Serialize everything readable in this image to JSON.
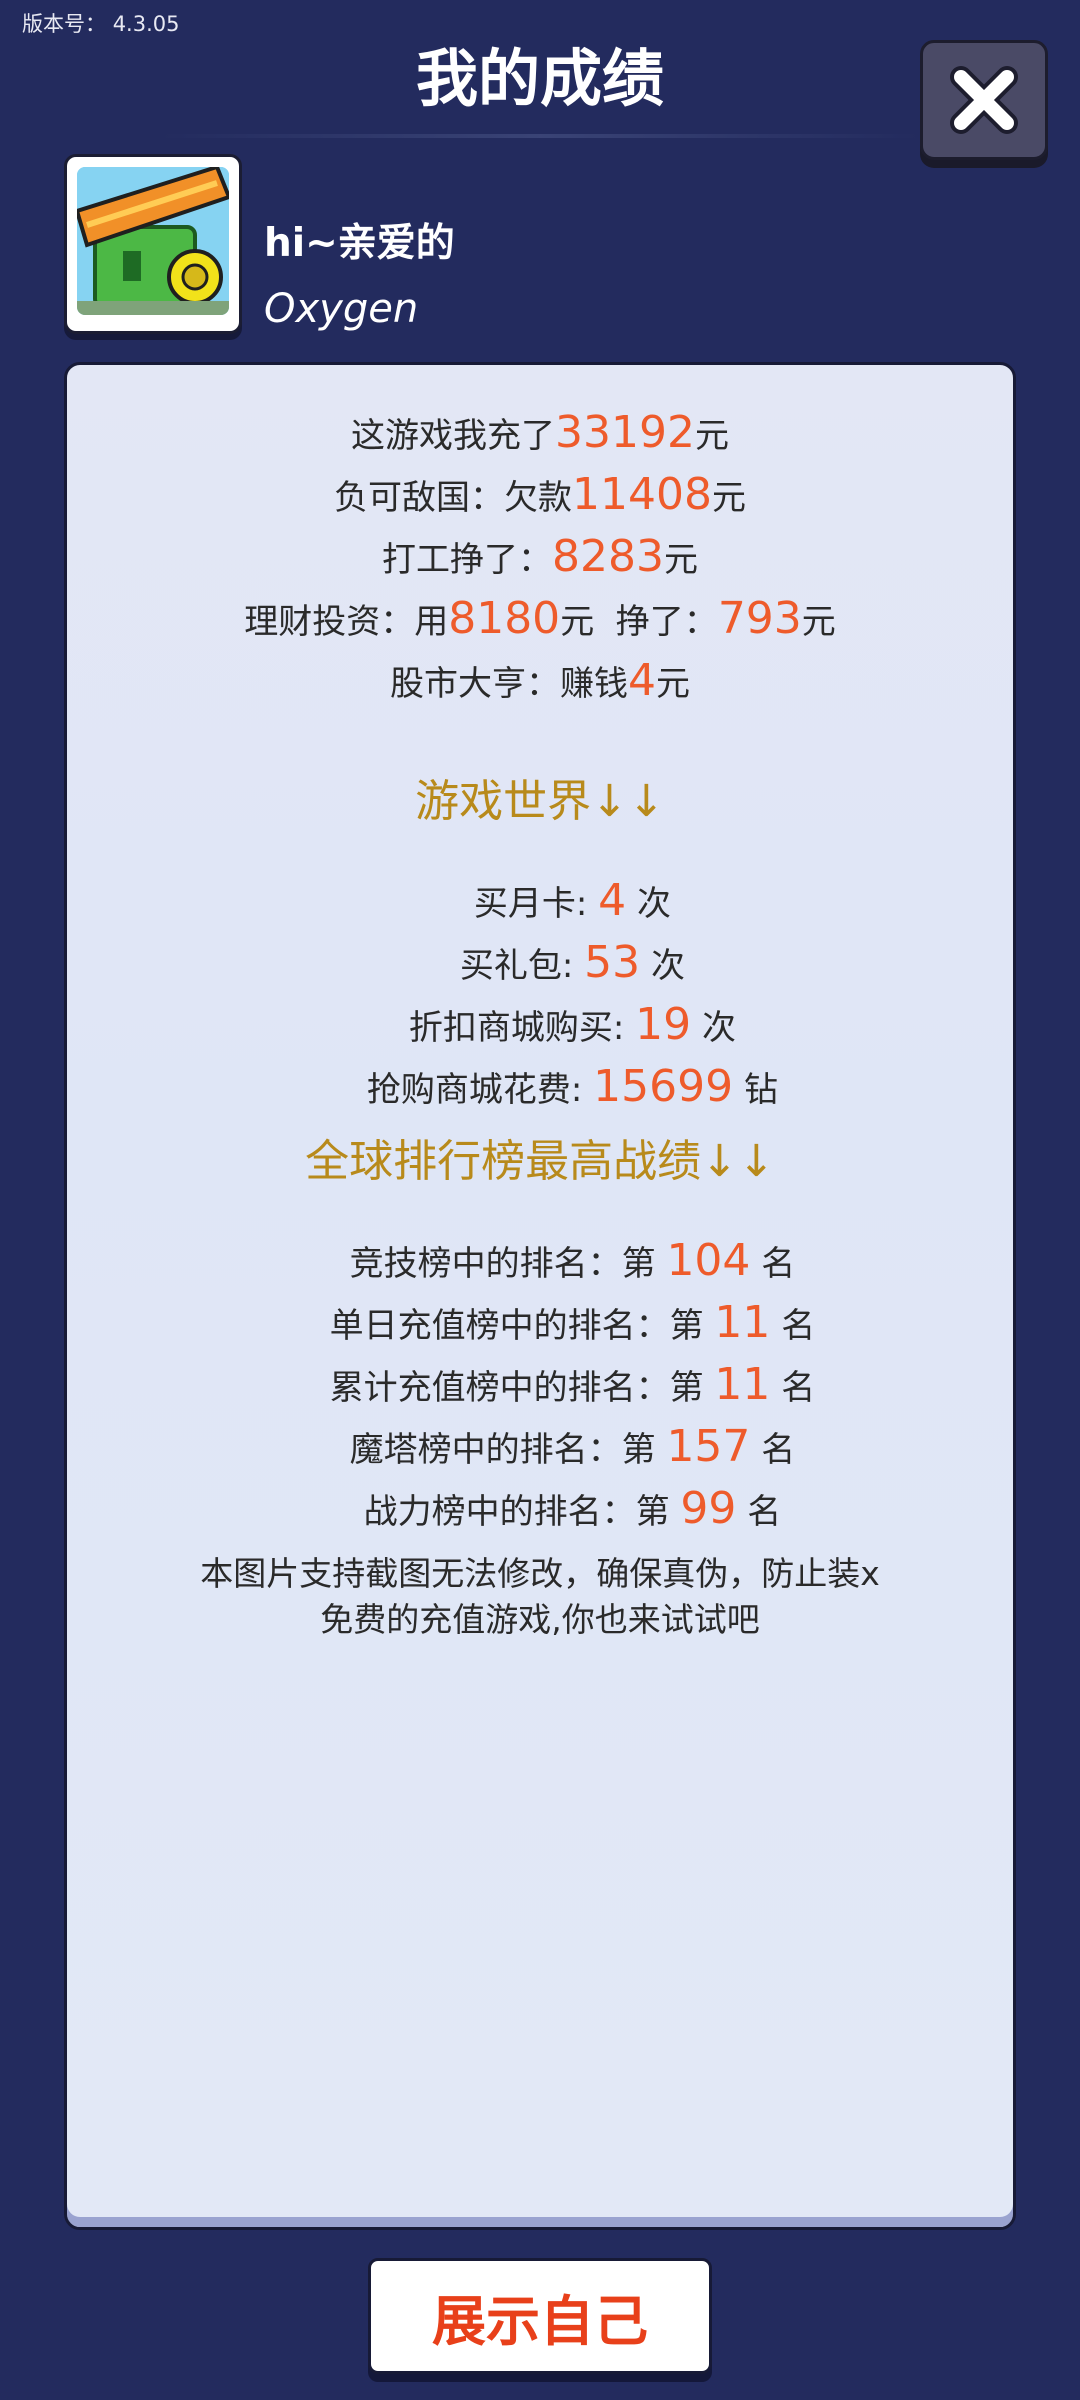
{
  "header": {
    "version_label": "版本号：",
    "version_value": "4.3.05",
    "title": "我的成绩"
  },
  "profile": {
    "greeting": "hi~亲爱的",
    "username": "Oxygen",
    "avatar_icon": "game-character-avatar"
  },
  "stats": {
    "recharge": {
      "prefix": "这游戏我充了",
      "value": "33192",
      "suffix": "元"
    },
    "debt": {
      "prefix": "负可敌国：欠款",
      "value": "11408",
      "suffix": "元"
    },
    "work": {
      "prefix": "打工挣了：",
      "value": "8283",
      "suffix": "元"
    },
    "invest": {
      "prefix": "理财投资：用",
      "value1": "8180",
      "mid": "元  挣了：",
      "value2": "793",
      "suffix": "元"
    },
    "stock": {
      "prefix": "股市大亨：赚钱",
      "value": "4",
      "suffix": "元"
    }
  },
  "game_world": {
    "heading": "游戏世界↓↓",
    "monthly_card": {
      "prefix": "买月卡: ",
      "value": "4",
      "suffix": " 次"
    },
    "gift_pack": {
      "prefix": "买礼包: ",
      "value": "53",
      "suffix": " 次"
    },
    "discount_shop": {
      "prefix": "折扣商城购买: ",
      "value": "19",
      "suffix": " 次"
    },
    "flash_shop": {
      "prefix": "抢购商城花费: ",
      "value": "15699",
      "suffix": " 钻"
    }
  },
  "rankings": {
    "heading": "全球排行榜最高战绩↓↓",
    "arena": {
      "prefix": "竞技榜中的排名：第 ",
      "value": "104",
      "suffix": " 名"
    },
    "daily_recharge": {
      "prefix": "单日充值榜中的排名：第 ",
      "value": "11",
      "suffix": " 名"
    },
    "total_recharge": {
      "prefix": "累计充值榜中的排名：第 ",
      "value": "11",
      "suffix": " 名"
    },
    "tower": {
      "prefix": "魔塔榜中的排名：第 ",
      "value": "157",
      "suffix": " 名"
    },
    "power": {
      "prefix": "战力榜中的排名：第 ",
      "value": "99",
      "suffix": " 名"
    }
  },
  "footer": {
    "line1": "本图片支持截图无法修改，确保真伪，防止装x",
    "line2": "免费的充值游戏,你也来试试吧"
  },
  "actions": {
    "show_label": "展示自己",
    "close_icon": "close-icon"
  },
  "colors": {
    "background": "#232b5e",
    "highlight": "#ee5b2b",
    "section": "#b88a1b",
    "button_text": "#e8401a"
  }
}
